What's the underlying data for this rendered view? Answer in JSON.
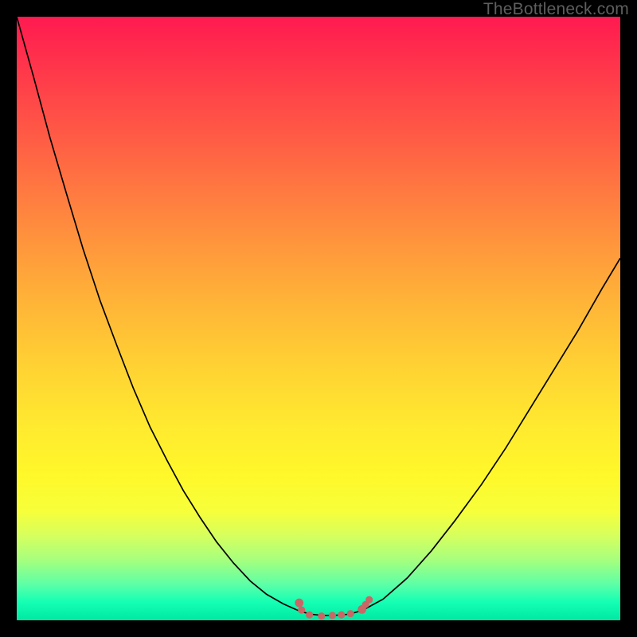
{
  "watermark": "TheBottleneck.com",
  "colors": {
    "gradient_top": "#ff1a50",
    "gradient_bottom": "#00e8a2",
    "curve": "#000000",
    "marker": "#c96767",
    "frame": "#000000"
  },
  "chart_data": {
    "type": "line",
    "title": "",
    "xlabel": "",
    "ylabel": "",
    "xlim": [
      0,
      100
    ],
    "ylim": [
      0,
      100
    ],
    "series": [
      {
        "name": "bottleneck-curve",
        "x": [
          0.0,
          2.8,
          5.5,
          8.3,
          11.0,
          13.8,
          16.6,
          19.3,
          22.1,
          24.9,
          27.6,
          30.4,
          33.1,
          35.9,
          38.7,
          41.4,
          44.2,
          46.9,
          48.8,
          50.7,
          52.5,
          55.0,
          57.2,
          60.7,
          64.7,
          68.7,
          72.6,
          77.0,
          81.0,
          85.0,
          89.0,
          93.0,
          97.0,
          100.0
        ],
        "y": [
          100.0,
          90.0,
          80.0,
          70.5,
          61.5,
          53.0,
          45.5,
          38.5,
          32.0,
          26.5,
          21.5,
          17.0,
          13.0,
          9.5,
          6.5,
          4.3,
          2.7,
          1.5,
          1.0,
          0.8,
          0.8,
          1.0,
          1.6,
          3.5,
          7.0,
          11.5,
          16.5,
          22.5,
          28.5,
          35.0,
          41.5,
          48.0,
          55.0,
          60.0
        ]
      }
    ],
    "markers": {
      "name": "bottleneck-markers",
      "points": [
        {
          "x": 46.8,
          "y": 2.9,
          "r": 1.3
        },
        {
          "x": 47.2,
          "y": 1.7,
          "r": 1.1
        },
        {
          "x": 48.5,
          "y": 0.9,
          "r": 1.1
        },
        {
          "x": 50.5,
          "y": 0.7,
          "r": 1.1
        },
        {
          "x": 52.3,
          "y": 0.8,
          "r": 1.1
        },
        {
          "x": 53.8,
          "y": 0.9,
          "r": 1.1
        },
        {
          "x": 55.3,
          "y": 1.1,
          "r": 1.1
        },
        {
          "x": 57.2,
          "y": 1.8,
          "r": 1.3
        },
        {
          "x": 57.8,
          "y": 2.6,
          "r": 1.1
        },
        {
          "x": 58.4,
          "y": 3.4,
          "r": 1.1
        }
      ]
    }
  }
}
